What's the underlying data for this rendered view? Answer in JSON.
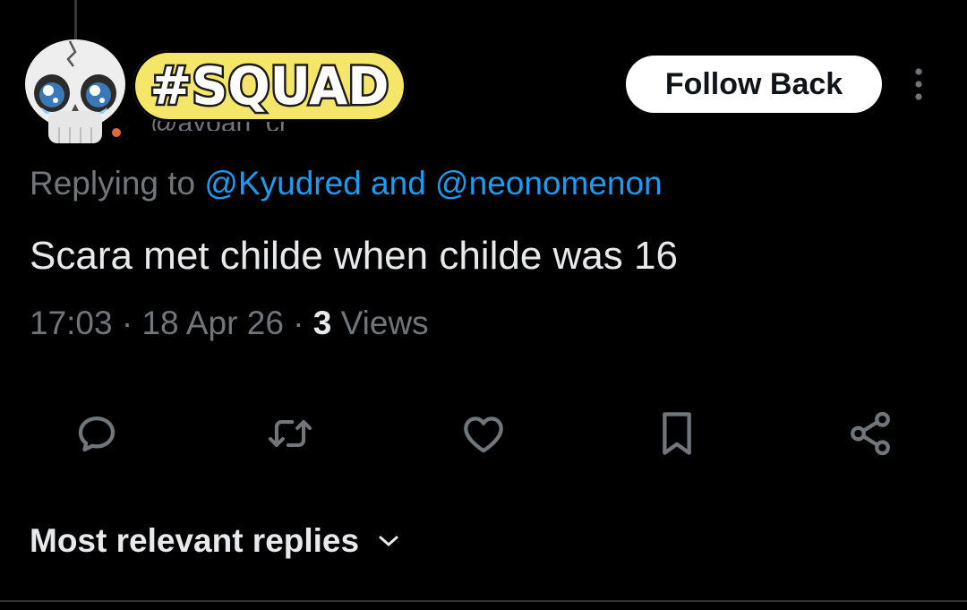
{
  "header": {
    "display_name_badge": "#SQUAD",
    "handle_partial": "@ayoan_cr",
    "follow_button_label": "Follow Back",
    "more_icon": "more-vertical-icon",
    "avatar_icon": "skull-emoji-avatar"
  },
  "reply": {
    "prefix": "Replying to",
    "mentions": "@Kyudred and @neonomenon"
  },
  "tweet": {
    "text": "Scara met childe when childe was 16",
    "time": "17:03",
    "date": "18 Apr 26",
    "views_count": "3",
    "views_label": "Views"
  },
  "actions": [
    {
      "name": "reply-icon"
    },
    {
      "name": "retweet-icon"
    },
    {
      "name": "like-icon"
    },
    {
      "name": "bookmark-icon"
    },
    {
      "name": "share-icon"
    }
  ],
  "replies_sort": {
    "label": "Most relevant replies",
    "icon": "chevron-down-icon"
  },
  "colors": {
    "background": "#000000",
    "text_primary": "#e7e9ea",
    "text_secondary": "#71767b",
    "link": "#1d9bf0",
    "badge": "#f5e66a",
    "follow_button_bg": "#ffffff"
  }
}
